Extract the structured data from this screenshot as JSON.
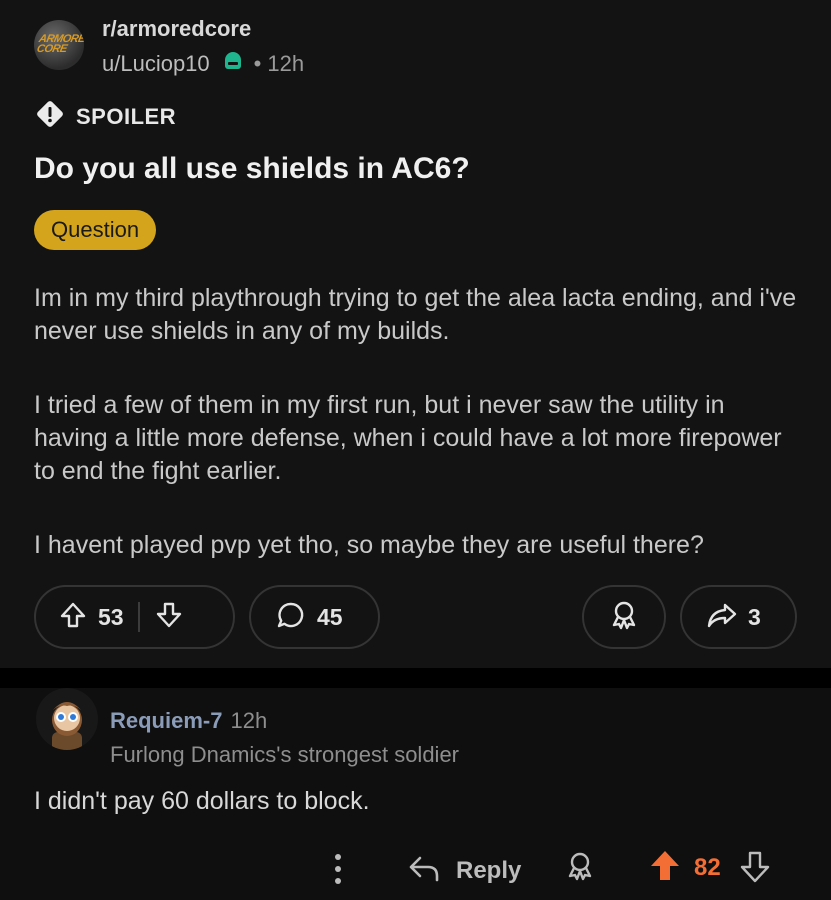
{
  "post": {
    "subreddit": "r/armoredcore",
    "subreddit_logo_text": "ARMORED CORE",
    "author": "u/Luciop10",
    "separator": "•",
    "time": "12h",
    "spoiler_label": "SPOILER",
    "title": "Do you all use shields in AC6?",
    "flair": "Question",
    "body": [
      "Im in my third playthrough trying to get the alea lacta ending, and i've never use shields in any of my builds.",
      "I tried a few of them in my first run, but i never saw the utility in having a little more defense, when i could have a lot more firepower to end the fight earlier.",
      "I havent played pvp yet tho, so maybe they are useful there?"
    ],
    "upvotes": "53",
    "comments": "45",
    "shares": "3"
  },
  "comment": {
    "author": "Requiem-7",
    "time": "12h",
    "user_flair": "Furlong Dnamics's strongest soldier",
    "body": "I didn't pay 60 dollars to block.",
    "reply_label": "Reply",
    "score": "82"
  },
  "colors": {
    "background": "#131313",
    "flair": "#d4a51c",
    "upvote_active": "#f36e35",
    "mod_badge": "#1fb58f"
  },
  "icons": [
    "mod-badge-icon",
    "spoiler-icon",
    "upvote-icon",
    "downvote-icon",
    "comment-icon",
    "award-icon",
    "share-icon",
    "more-icon",
    "reply-icon"
  ]
}
